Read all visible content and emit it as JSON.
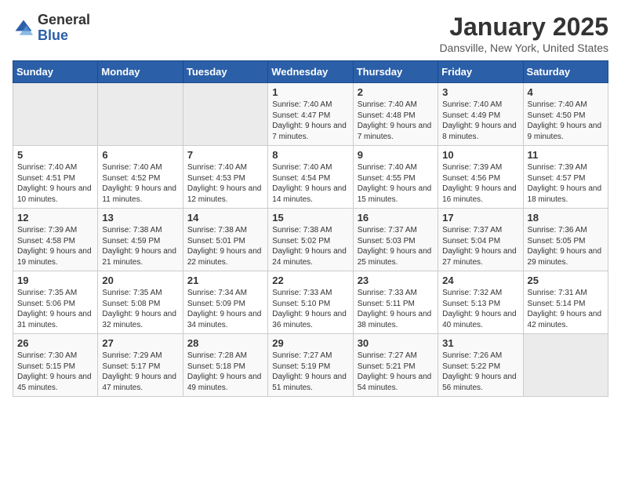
{
  "header": {
    "logo_line1": "General",
    "logo_line2": "Blue",
    "title": "January 2025",
    "subtitle": "Dansville, New York, United States"
  },
  "weekdays": [
    "Sunday",
    "Monday",
    "Tuesday",
    "Wednesday",
    "Thursday",
    "Friday",
    "Saturday"
  ],
  "weeks": [
    [
      {
        "day": "",
        "sunrise": "",
        "sunset": "",
        "daylight": ""
      },
      {
        "day": "",
        "sunrise": "",
        "sunset": "",
        "daylight": ""
      },
      {
        "day": "",
        "sunrise": "",
        "sunset": "",
        "daylight": ""
      },
      {
        "day": "1",
        "sunrise": "Sunrise: 7:40 AM",
        "sunset": "Sunset: 4:47 PM",
        "daylight": "Daylight: 9 hours and 7 minutes."
      },
      {
        "day": "2",
        "sunrise": "Sunrise: 7:40 AM",
        "sunset": "Sunset: 4:48 PM",
        "daylight": "Daylight: 9 hours and 7 minutes."
      },
      {
        "day": "3",
        "sunrise": "Sunrise: 7:40 AM",
        "sunset": "Sunset: 4:49 PM",
        "daylight": "Daylight: 9 hours and 8 minutes."
      },
      {
        "day": "4",
        "sunrise": "Sunrise: 7:40 AM",
        "sunset": "Sunset: 4:50 PM",
        "daylight": "Daylight: 9 hours and 9 minutes."
      }
    ],
    [
      {
        "day": "5",
        "sunrise": "Sunrise: 7:40 AM",
        "sunset": "Sunset: 4:51 PM",
        "daylight": "Daylight: 9 hours and 10 minutes."
      },
      {
        "day": "6",
        "sunrise": "Sunrise: 7:40 AM",
        "sunset": "Sunset: 4:52 PM",
        "daylight": "Daylight: 9 hours and 11 minutes."
      },
      {
        "day": "7",
        "sunrise": "Sunrise: 7:40 AM",
        "sunset": "Sunset: 4:53 PM",
        "daylight": "Daylight: 9 hours and 12 minutes."
      },
      {
        "day": "8",
        "sunrise": "Sunrise: 7:40 AM",
        "sunset": "Sunset: 4:54 PM",
        "daylight": "Daylight: 9 hours and 14 minutes."
      },
      {
        "day": "9",
        "sunrise": "Sunrise: 7:40 AM",
        "sunset": "Sunset: 4:55 PM",
        "daylight": "Daylight: 9 hours and 15 minutes."
      },
      {
        "day": "10",
        "sunrise": "Sunrise: 7:39 AM",
        "sunset": "Sunset: 4:56 PM",
        "daylight": "Daylight: 9 hours and 16 minutes."
      },
      {
        "day": "11",
        "sunrise": "Sunrise: 7:39 AM",
        "sunset": "Sunset: 4:57 PM",
        "daylight": "Daylight: 9 hours and 18 minutes."
      }
    ],
    [
      {
        "day": "12",
        "sunrise": "Sunrise: 7:39 AM",
        "sunset": "Sunset: 4:58 PM",
        "daylight": "Daylight: 9 hours and 19 minutes."
      },
      {
        "day": "13",
        "sunrise": "Sunrise: 7:38 AM",
        "sunset": "Sunset: 4:59 PM",
        "daylight": "Daylight: 9 hours and 21 minutes."
      },
      {
        "day": "14",
        "sunrise": "Sunrise: 7:38 AM",
        "sunset": "Sunset: 5:01 PM",
        "daylight": "Daylight: 9 hours and 22 minutes."
      },
      {
        "day": "15",
        "sunrise": "Sunrise: 7:38 AM",
        "sunset": "Sunset: 5:02 PM",
        "daylight": "Daylight: 9 hours and 24 minutes."
      },
      {
        "day": "16",
        "sunrise": "Sunrise: 7:37 AM",
        "sunset": "Sunset: 5:03 PM",
        "daylight": "Daylight: 9 hours and 25 minutes."
      },
      {
        "day": "17",
        "sunrise": "Sunrise: 7:37 AM",
        "sunset": "Sunset: 5:04 PM",
        "daylight": "Daylight: 9 hours and 27 minutes."
      },
      {
        "day": "18",
        "sunrise": "Sunrise: 7:36 AM",
        "sunset": "Sunset: 5:05 PM",
        "daylight": "Daylight: 9 hours and 29 minutes."
      }
    ],
    [
      {
        "day": "19",
        "sunrise": "Sunrise: 7:35 AM",
        "sunset": "Sunset: 5:06 PM",
        "daylight": "Daylight: 9 hours and 31 minutes."
      },
      {
        "day": "20",
        "sunrise": "Sunrise: 7:35 AM",
        "sunset": "Sunset: 5:08 PM",
        "daylight": "Daylight: 9 hours and 32 minutes."
      },
      {
        "day": "21",
        "sunrise": "Sunrise: 7:34 AM",
        "sunset": "Sunset: 5:09 PM",
        "daylight": "Daylight: 9 hours and 34 minutes."
      },
      {
        "day": "22",
        "sunrise": "Sunrise: 7:33 AM",
        "sunset": "Sunset: 5:10 PM",
        "daylight": "Daylight: 9 hours and 36 minutes."
      },
      {
        "day": "23",
        "sunrise": "Sunrise: 7:33 AM",
        "sunset": "Sunset: 5:11 PM",
        "daylight": "Daylight: 9 hours and 38 minutes."
      },
      {
        "day": "24",
        "sunrise": "Sunrise: 7:32 AM",
        "sunset": "Sunset: 5:13 PM",
        "daylight": "Daylight: 9 hours and 40 minutes."
      },
      {
        "day": "25",
        "sunrise": "Sunrise: 7:31 AM",
        "sunset": "Sunset: 5:14 PM",
        "daylight": "Daylight: 9 hours and 42 minutes."
      }
    ],
    [
      {
        "day": "26",
        "sunrise": "Sunrise: 7:30 AM",
        "sunset": "Sunset: 5:15 PM",
        "daylight": "Daylight: 9 hours and 45 minutes."
      },
      {
        "day": "27",
        "sunrise": "Sunrise: 7:29 AM",
        "sunset": "Sunset: 5:17 PM",
        "daylight": "Daylight: 9 hours and 47 minutes."
      },
      {
        "day": "28",
        "sunrise": "Sunrise: 7:28 AM",
        "sunset": "Sunset: 5:18 PM",
        "daylight": "Daylight: 9 hours and 49 minutes."
      },
      {
        "day": "29",
        "sunrise": "Sunrise: 7:27 AM",
        "sunset": "Sunset: 5:19 PM",
        "daylight": "Daylight: 9 hours and 51 minutes."
      },
      {
        "day": "30",
        "sunrise": "Sunrise: 7:27 AM",
        "sunset": "Sunset: 5:21 PM",
        "daylight": "Daylight: 9 hours and 54 minutes."
      },
      {
        "day": "31",
        "sunrise": "Sunrise: 7:26 AM",
        "sunset": "Sunset: 5:22 PM",
        "daylight": "Daylight: 9 hours and 56 minutes."
      },
      {
        "day": "",
        "sunrise": "",
        "sunset": "",
        "daylight": ""
      }
    ]
  ]
}
